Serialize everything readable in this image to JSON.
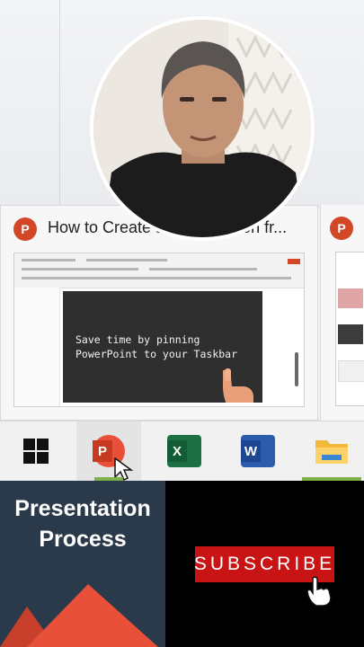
{
  "thumbnail": {
    "title": "How to Create a Presentation fr..."
  },
  "slide": {
    "line1": "Save time by pinning",
    "line2": "PowerPoint to your Taskbar"
  },
  "taskbar": {
    "items": [
      {
        "name": "windows-start",
        "icon": "windows-logo-icon"
      },
      {
        "name": "powerpoint",
        "icon": "powerpoint-icon",
        "letter": "P",
        "active": true
      },
      {
        "name": "excel",
        "icon": "excel-icon",
        "letter": "X"
      },
      {
        "name": "word",
        "icon": "word-icon",
        "letter": "W"
      },
      {
        "name": "file-explorer",
        "icon": "folder-icon"
      }
    ]
  },
  "promo": {
    "title_line1": "Presentation",
    "title_line2": "Process",
    "subscribe_label": "SUBSCRIBE"
  },
  "colors": {
    "powerpoint": "#d24726",
    "excel": "#1d7044",
    "word": "#2b5cae",
    "promo_bg": "#2b3a4a",
    "subscribe": "#c81414",
    "accent_orange": "#e8503a"
  }
}
